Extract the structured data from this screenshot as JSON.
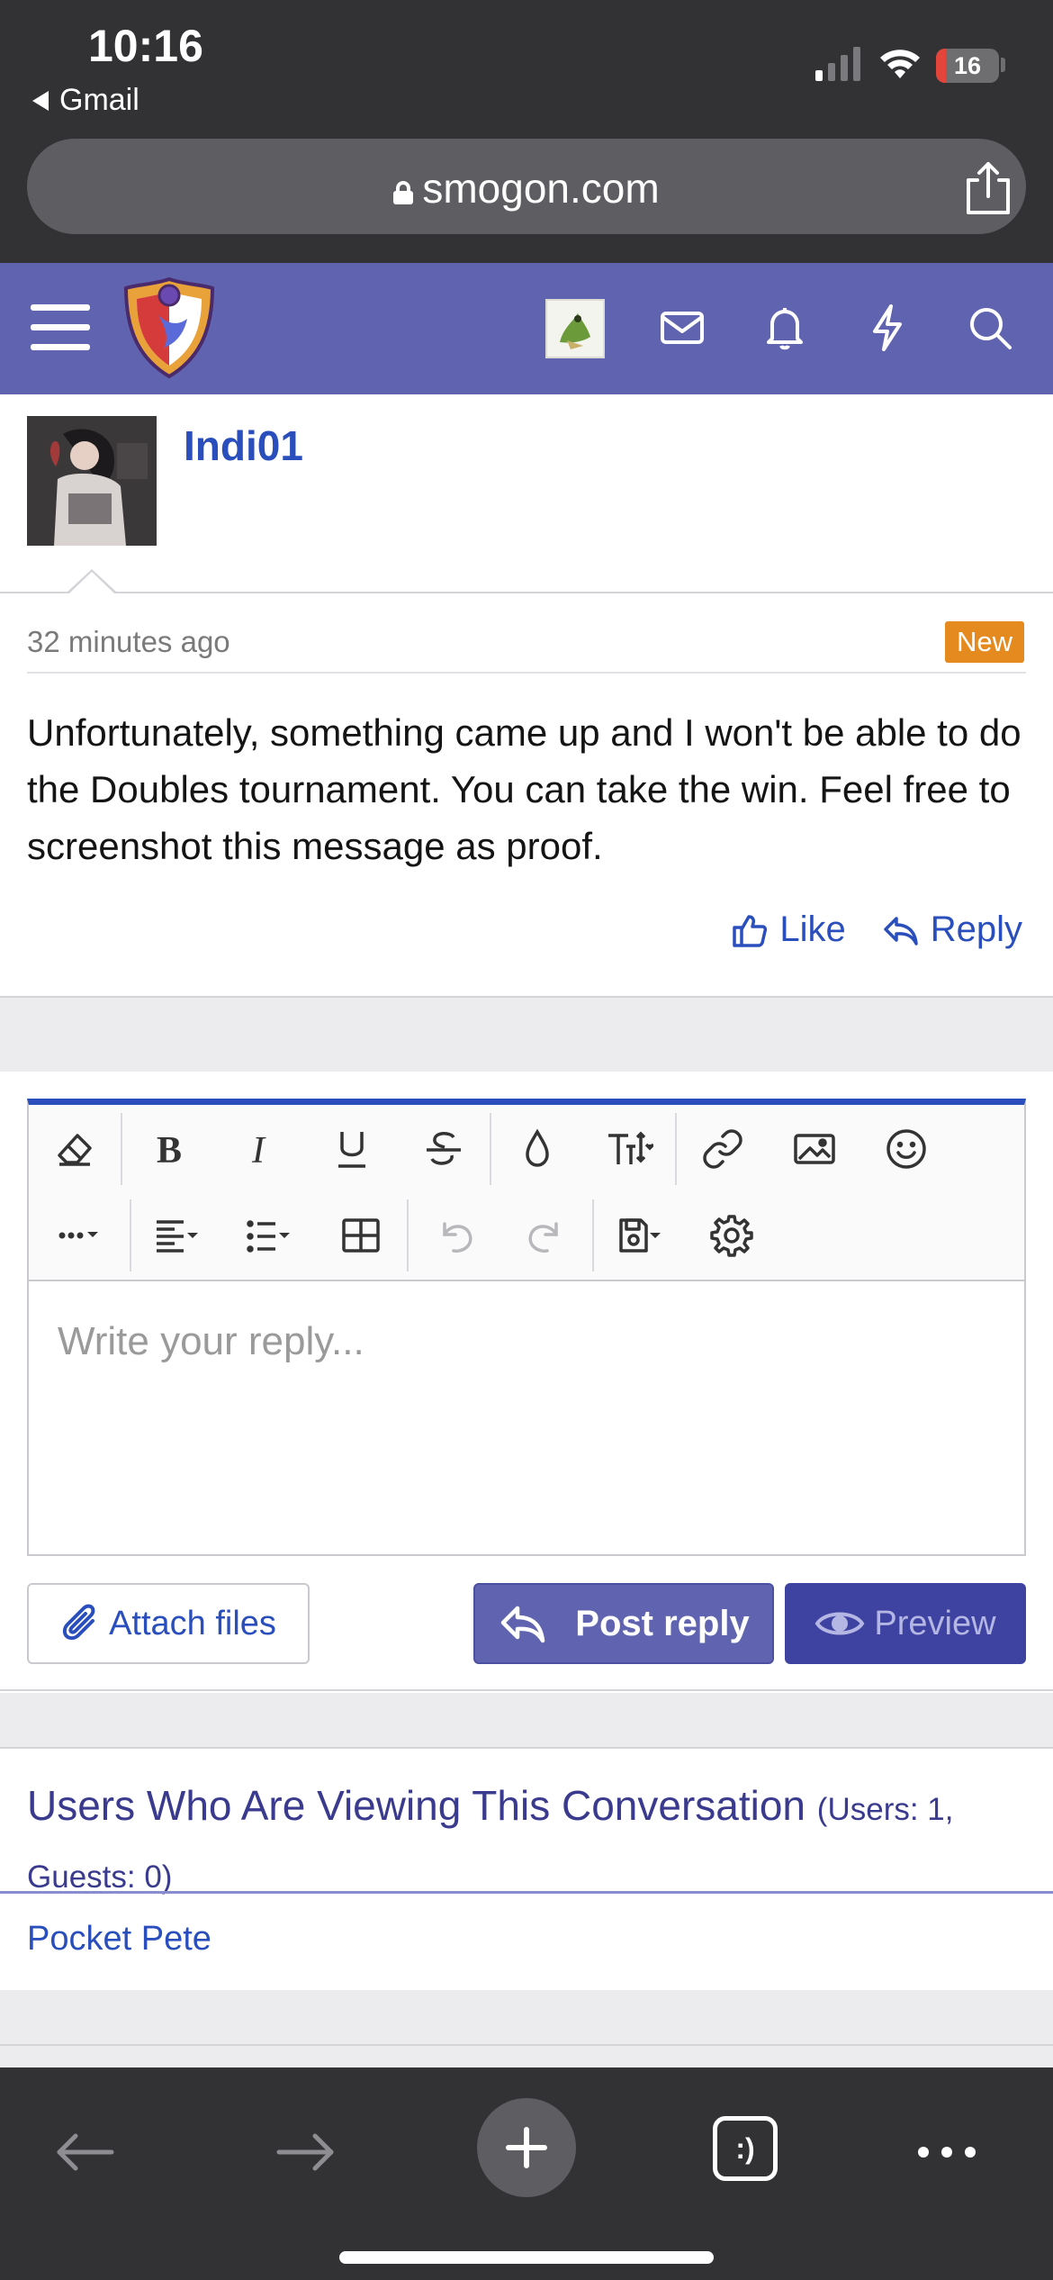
{
  "status_bar": {
    "time": "10:16",
    "back_app": "Gmail",
    "battery": "16",
    "battery_level_percent": 16
  },
  "browser": {
    "url": "smogon.com",
    "icons": [
      "lock-icon",
      "share-icon",
      "back-arrow-icon",
      "forward-arrow-icon",
      "plus-icon",
      "tabs-icon",
      "more-icon"
    ],
    "tabs_label": ":)"
  },
  "site_nav": {
    "icons": [
      "hamburger-menu-icon",
      "smogon-logo",
      "user-avatar",
      "mail-icon",
      "bell-icon",
      "bolt-icon",
      "search-icon"
    ],
    "accent": "#6064b0"
  },
  "message": {
    "username": "Indi01",
    "time": "32 minutes ago",
    "badge": "New",
    "text": "Unfortunately, something came up and I won't be able to do the Doubles tournament. You can take the win. Feel free to screenshot this message as proof.",
    "like_label": "Like",
    "reply_label": "Reply"
  },
  "editor": {
    "placeholder": "Write your reply...",
    "toolbar_row1": [
      "eraser-icon",
      "bold-icon",
      "italic-icon",
      "underline-icon",
      "strikethrough-icon",
      "text-color-icon",
      "font-size-icon",
      "link-icon",
      "image-icon",
      "emoji-icon"
    ],
    "toolbar_row2": [
      "more-options-icon",
      "align-icon",
      "list-icon",
      "table-icon",
      "undo-icon",
      "redo-icon",
      "drafts-icon",
      "settings-icon"
    ],
    "attach_label": "Attach files",
    "post_label": "Post reply",
    "preview_label": "Preview"
  },
  "viewers": {
    "title": "Users Who Are Viewing This Conversation",
    "count": "(Users: 1, Guests: 0)",
    "users": [
      "Pocket Pete"
    ]
  },
  "colors": {
    "link": "#2a4fbd",
    "badge": "#e48a1f",
    "browser_chrome": "#323235"
  }
}
